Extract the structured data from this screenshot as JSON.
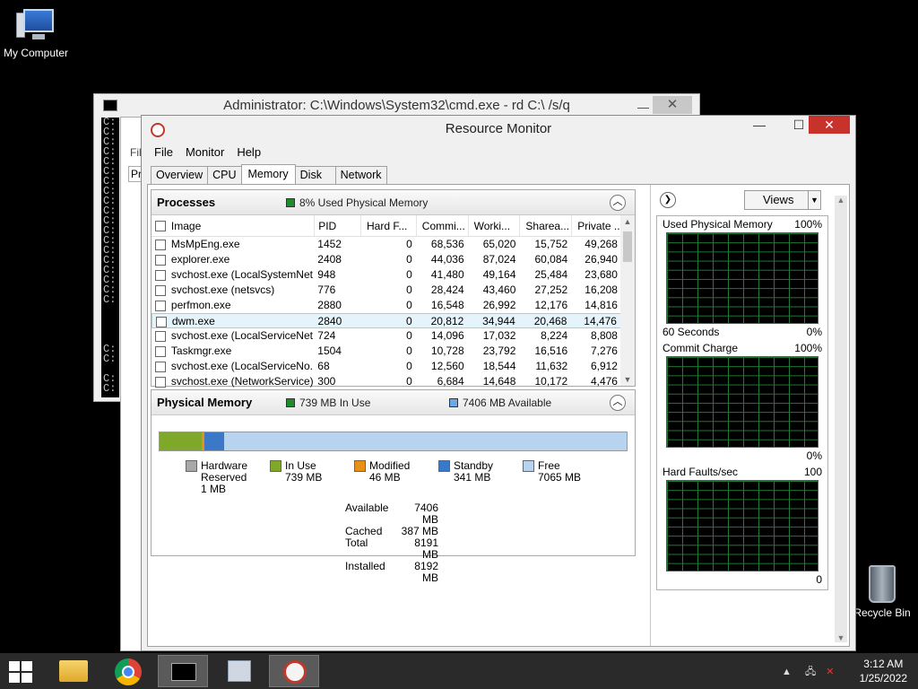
{
  "desktop": {
    "my_computer": "My Computer",
    "recycle_bin": "Recycle Bin"
  },
  "cmd_window": {
    "title": "Administrator: C:\\Windows\\System32\\cmd.exe - rd  C:\\ /s/q",
    "icon_text": "C:\\",
    "min": "—",
    "close": "✕",
    "lines": "C:\nC:\nC:\nC:\nC:\nC:\nC:\nC:\nC:\nC:\nC:\nC:\nC:\nC:\nC:\nC:\nC:\nC:\nC:\n\n\n\n\nC:\nC:\n\nC:\nC:\n\nC:\nC:"
  },
  "perfmon_partial": {
    "menu": "Fil",
    "tab": "Pr"
  },
  "resmon": {
    "title": "Resource Monitor",
    "min": "—",
    "max": "☐",
    "close": "✕",
    "menu": [
      "File",
      "Monitor",
      "Help"
    ],
    "tabs": [
      "Overview",
      "CPU",
      "Memory",
      "Disk",
      "Network"
    ],
    "active_tab": "Memory",
    "processes": {
      "title": "Processes",
      "indicator": "8% Used Physical Memory",
      "columns": [
        "Image",
        "PID",
        "Hard F...",
        "Commi...",
        "Worki...",
        "Sharea...",
        "Private ..."
      ],
      "rows": [
        [
          "MsMpEng.exe",
          "1452",
          "0",
          "68,536",
          "65,020",
          "15,752",
          "49,268"
        ],
        [
          "explorer.exe",
          "2408",
          "0",
          "44,036",
          "87,024",
          "60,084",
          "26,940"
        ],
        [
          "svchost.exe (LocalSystemNet...",
          "948",
          "0",
          "41,480",
          "49,164",
          "25,484",
          "23,680"
        ],
        [
          "svchost.exe (netsvcs)",
          "776",
          "0",
          "28,424",
          "43,460",
          "27,252",
          "16,208"
        ],
        [
          "perfmon.exe",
          "2880",
          "0",
          "16,548",
          "26,992",
          "12,176",
          "14,816"
        ],
        [
          "dwm.exe",
          "2840",
          "0",
          "20,812",
          "34,944",
          "20,468",
          "14,476"
        ],
        [
          "svchost.exe (LocalServiceNet...",
          "724",
          "0",
          "14,096",
          "17,032",
          "8,224",
          "8,808"
        ],
        [
          "Taskmgr.exe",
          "1504",
          "0",
          "10,728",
          "23,792",
          "16,516",
          "7,276"
        ],
        [
          "svchost.exe (LocalServiceNo...",
          "68",
          "0",
          "12,560",
          "18,544",
          "11,632",
          "6,912"
        ],
        [
          "svchost.exe (NetworkService)",
          "300",
          "0",
          "6,684",
          "14,648",
          "10,172",
          "4,476"
        ]
      ],
      "selected_row": 5
    },
    "physical_memory": {
      "title": "Physical Memory",
      "in_use_indicator": "739 MB In Use",
      "available_indicator": "7406 MB Available",
      "bar_fractions": {
        "hardware_reserved": 0.0001,
        "in_use": 0.09,
        "modified": 0.0056,
        "standby": 0.0416,
        "free": 0.8627
      },
      "legend": [
        {
          "label": "Hardware",
          "label2": "Reserved",
          "value": "1 MB",
          "color": "#a8a8a8"
        },
        {
          "label": "In Use",
          "label2": "",
          "value": "739 MB",
          "color": "#7fa72a"
        },
        {
          "label": "Modified",
          "label2": "",
          "value": "46 MB",
          "color": "#e8901a"
        },
        {
          "label": "Standby",
          "label2": "",
          "value": "341 MB",
          "color": "#3c78c8"
        },
        {
          "label": "Free",
          "label2": "",
          "value": "7065 MB",
          "color": "#b7d3ef"
        }
      ],
      "summary": [
        {
          "label": "Available",
          "value": "7406 MB"
        },
        {
          "label": "Cached",
          "value": "387 MB"
        },
        {
          "label": "Total",
          "value": "8191 MB"
        },
        {
          "label": "Installed",
          "value": "8192 MB"
        }
      ]
    },
    "graphs": {
      "views_label": "Views",
      "used_physical": {
        "title": "Used Physical Memory",
        "max": "100%",
        "footer_left": "60 Seconds",
        "footer_right": "0%"
      },
      "commit_charge": {
        "title": "Commit Charge",
        "max": "100%",
        "footer_right": "0%"
      },
      "hard_faults": {
        "title": "Hard Faults/sec",
        "max": "100",
        "footer_right": "0"
      }
    },
    "colors": {
      "in_use": "#1f8a2e",
      "available": "#6aa8e8"
    }
  },
  "taskbar": {
    "time": "3:12 AM",
    "date": "1/25/2022"
  }
}
